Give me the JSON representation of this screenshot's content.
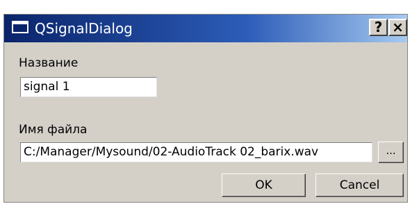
{
  "window": {
    "title": "QSignalDialog",
    "help_label": "?",
    "close_label": "×"
  },
  "form": {
    "name_label": "Название",
    "name_value": "signal 1",
    "file_label": "Имя файла",
    "file_value": "C:/Manager/Mysound/02-AudioTrack 02_barix.wav",
    "browse_label": "..."
  },
  "buttons": {
    "ok_label": "OK",
    "cancel_label": "Cancel"
  },
  "colors": {
    "titlebar_start": "#0a246a",
    "titlebar_end": "#a6caf0",
    "dialog_bg": "#d4d0c8"
  }
}
